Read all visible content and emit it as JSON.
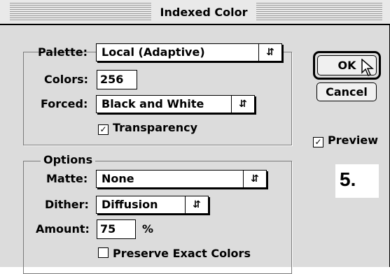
{
  "window": {
    "title": "Indexed Color"
  },
  "palette_group": {
    "palette_label": "Palette:",
    "palette_value": "Local (Adaptive)",
    "colors_label": "Colors:",
    "colors_value": "256",
    "forced_label": "Forced:",
    "forced_value": "Black and White",
    "transparency_label": "Transparency",
    "transparency_checked": true
  },
  "options_group": {
    "title": "Options",
    "matte_label": "Matte:",
    "matte_value": "None",
    "dither_label": "Dither:",
    "dither_value": "Diffusion",
    "amount_label": "Amount:",
    "amount_value": "75",
    "amount_unit": "%",
    "preserve_label": "Preserve Exact Colors",
    "preserve_checked": false
  },
  "buttons": {
    "ok": "OK",
    "cancel": "Cancel"
  },
  "preview": {
    "label": "Preview",
    "checked": true
  },
  "step_label": "5.",
  "icons": {
    "popup_arrow": "up-down-arrows-icon",
    "checkmark": "checkmark-icon",
    "cursor": "mouse-pointer-icon"
  }
}
